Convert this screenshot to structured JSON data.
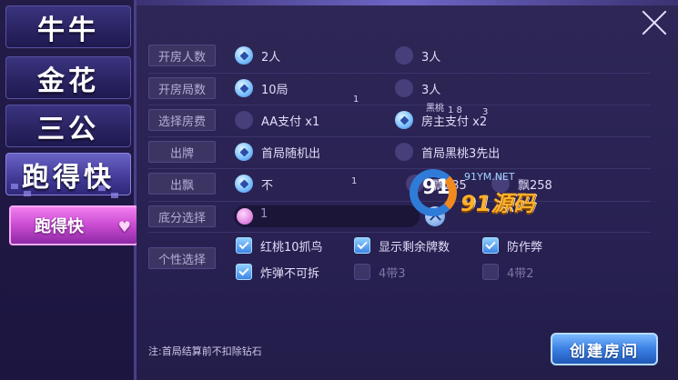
{
  "sidebar": {
    "games": [
      {
        "label": "牛牛"
      },
      {
        "label": "金花"
      },
      {
        "label": "三公"
      },
      {
        "label": "跑得快"
      }
    ],
    "mode_tab": "跑得快"
  },
  "rows": {
    "players": {
      "label": "开房人数",
      "options": [
        "2人",
        "3人"
      ],
      "selected": 0
    },
    "rounds": {
      "label": "开房局数",
      "options": [
        "10局",
        "3人"
      ],
      "selected": 0
    },
    "fee": {
      "label": "选择房费",
      "options": [
        "AA支付 x1",
        "房主支付 x2"
      ],
      "selected": 1
    },
    "first": {
      "label": "出牌",
      "options": [
        "首局随机出",
        "首局黑桃3先出"
      ],
      "selected": 0
    },
    "piao": {
      "label": "出飘",
      "options": [
        "不",
        "飘235",
        "飘258"
      ],
      "selected": 0
    },
    "base": {
      "label": "底分选择",
      "value": "1"
    },
    "personal": {
      "label": "个性选择",
      "checks": [
        {
          "label": "红桃10抓鸟",
          "on": true
        },
        {
          "label": "显示剩余牌数",
          "on": true
        },
        {
          "label": "防作弊",
          "on": true
        },
        {
          "label": "炸弹不可拆",
          "on": true
        },
        {
          "label": "4带3",
          "on": false
        },
        {
          "label": "4带2",
          "on": false
        }
      ]
    }
  },
  "footer": {
    "note": "注:首局结算前不扣除钻石",
    "create_button": "创建房间"
  },
  "overlay": {
    "stray_1": "1",
    "stray_2": "黑桃",
    "stray_3": "1 8",
    "stray_4": "3",
    "stray_5": "1",
    "watermark_num": "91",
    "watermark_url": "91YM.NET",
    "watermark_brand": "91源码"
  },
  "colors": {
    "accent": "#3f7ddb",
    "mode_tab": "#c84ad0",
    "panel": "#2a2354"
  }
}
